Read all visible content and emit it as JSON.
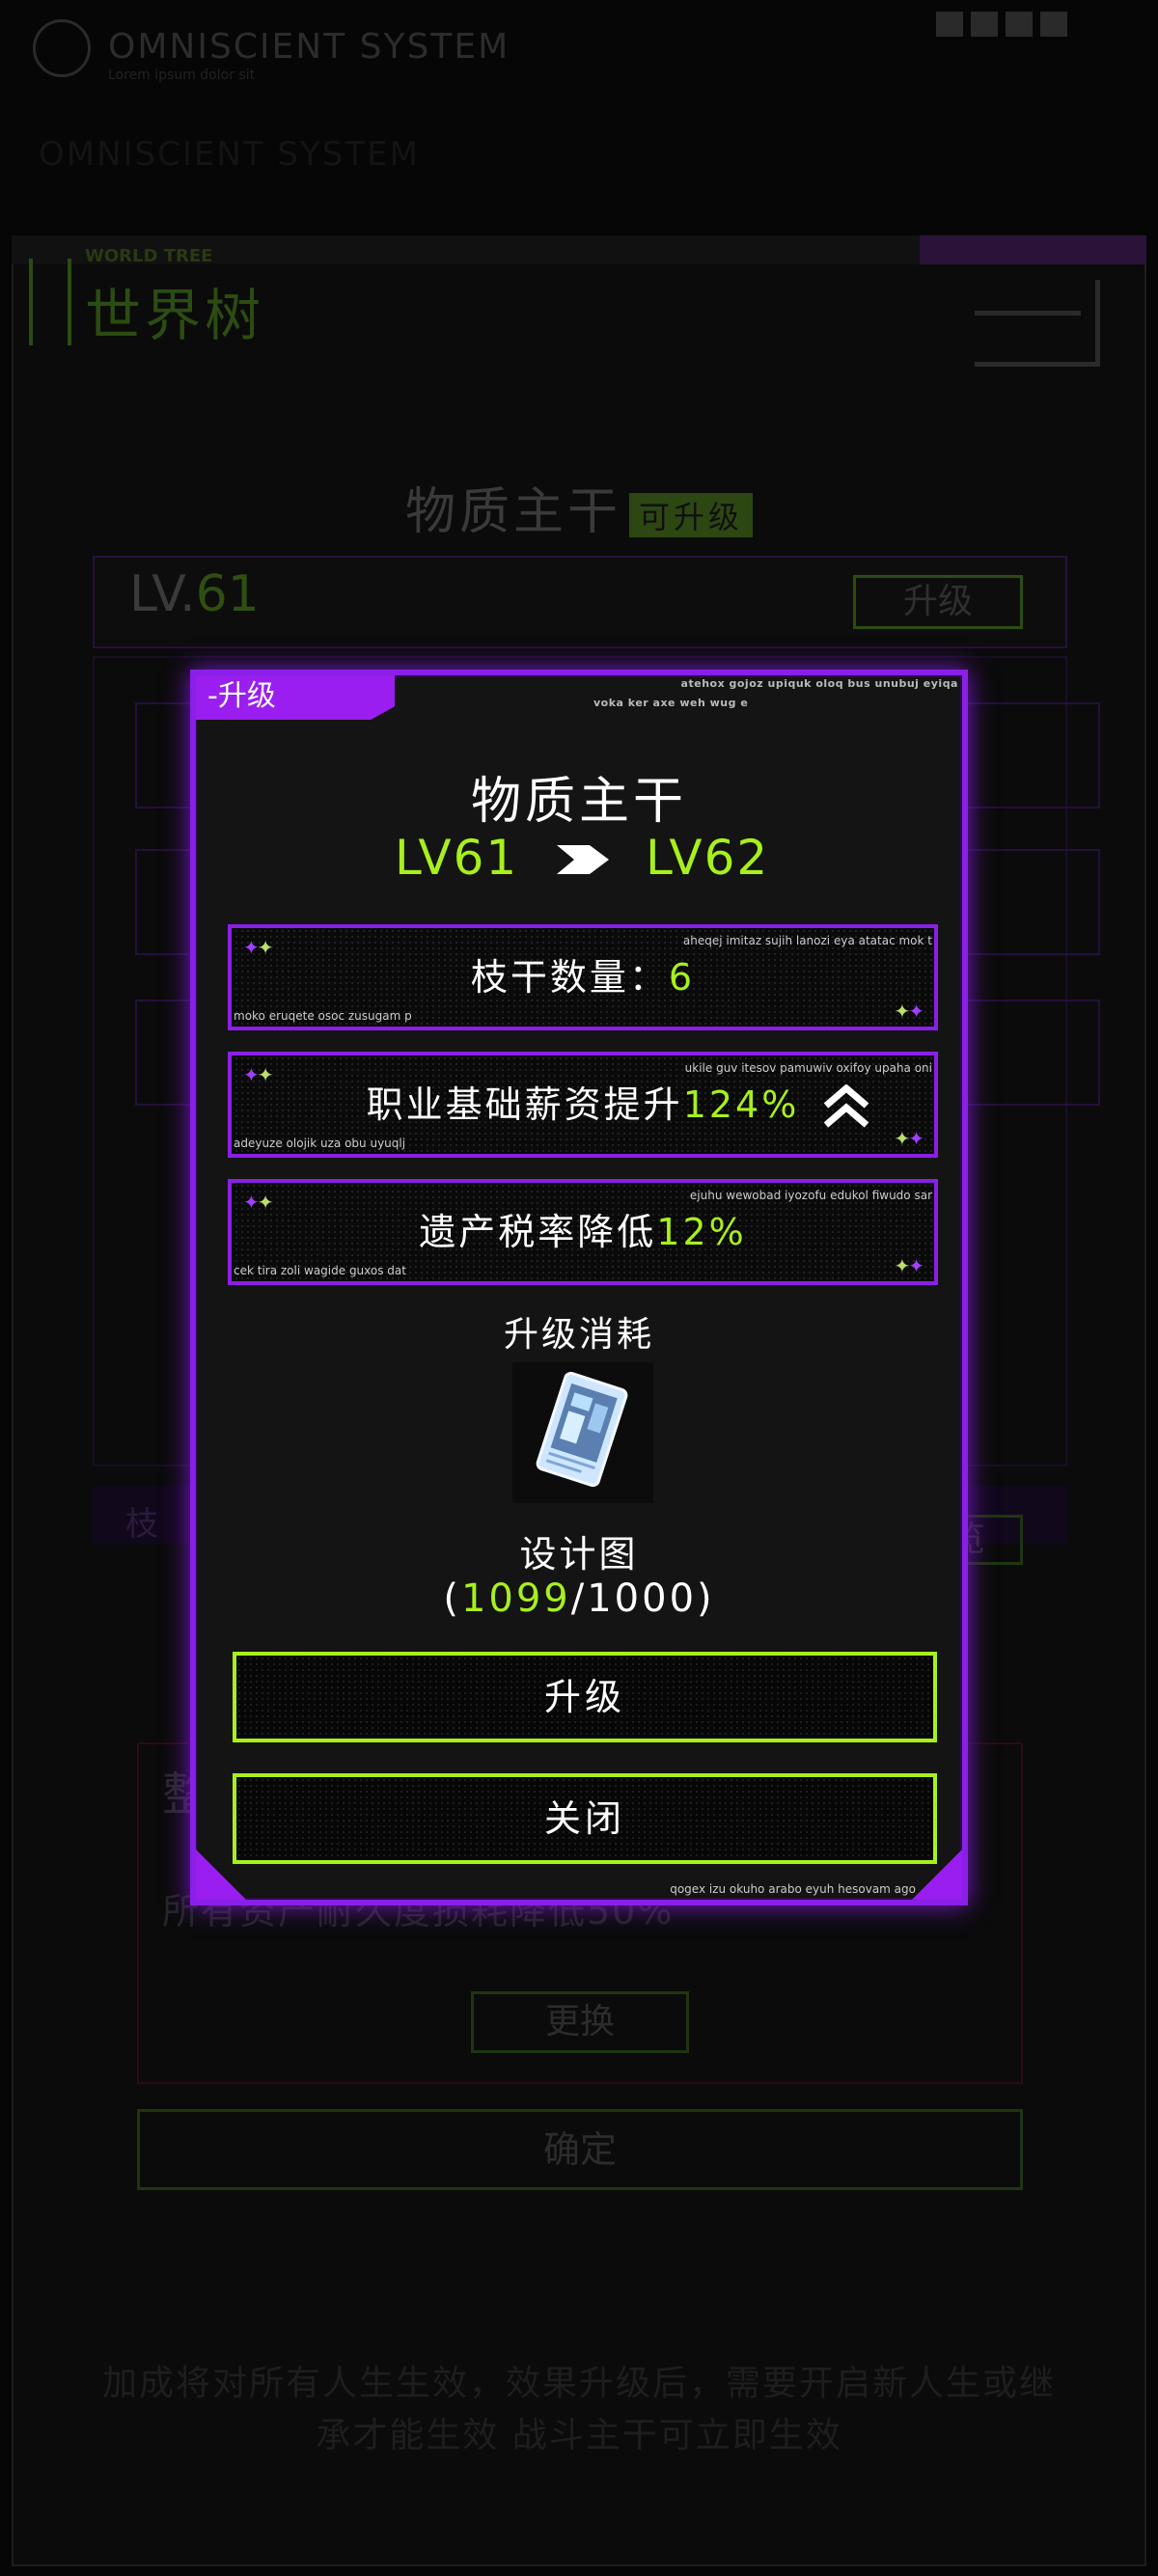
{
  "background": {
    "system_title": "OMNISCIENT SYSTEM",
    "system_sub": "Lorem ipsum dolor sit",
    "system_title2": "OMNISCIENT SYSTEM",
    "world_tree_en": "WORLD TREE",
    "world_tree": "世界树",
    "main_title": "物质主干",
    "main_badge": "可升级",
    "level": "LV.",
    "level_num": "61",
    "level_upgrade": "升级",
    "branch_label": "枝",
    "total_overview": "加成总览",
    "red_card_title": "整",
    "red_card_desc": "所有资产耐久度损耗降低50%",
    "change_button": "更换",
    "confirm_button": "确定",
    "note": "加成将对所有人生生效，效果升级后，需要开启新人生或继承才能生效 战斗主干可立即生效"
  },
  "modal": {
    "tag": "升级",
    "tag_prefix": "-",
    "top_deco_1": "atehox gojoz upiquk oloq bus unubuj eyiqa",
    "top_deco_2": "voka ker axe weh wug e",
    "name": "物质主干",
    "from_level": "LV61",
    "to_level": "LV62",
    "stats": [
      {
        "label": "枝干数量：",
        "value": "6",
        "deco_top": "aheqej imitaz sujih lanozi eya atatac mok t",
        "deco_bottom": "moko eruqete osoc zusugam p"
      },
      {
        "label": "职业基础薪资提升",
        "value": "124%",
        "deco_top": "ukile guv itesov pamuwiv oxifoy upaha oni",
        "deco_bottom": "adeyuze olojik uza obu uyuqlj"
      },
      {
        "label": "遗产税率降低",
        "value": "12%",
        "deco_top": "ejuhu wewobad iyozofu edukol fiwudo sar",
        "deco_bottom": "cek tira zoli wagide guxos dat"
      }
    ],
    "cost_title": "升级消耗",
    "item_name": "设计图",
    "item_have": "1099",
    "item_need": "1000",
    "upgrade_button": "升级",
    "close_button": "关闭",
    "footer_deco": "qogex izu okuho arabo eyuh hesovam ago"
  },
  "colors": {
    "accent_purple": "#8a1fe8",
    "accent_green": "#a8f01c"
  },
  "icons": [
    "chevron-right-icon",
    "double-up-arrow-icon",
    "sparkle-icon",
    "blueprint-card-icon"
  ]
}
